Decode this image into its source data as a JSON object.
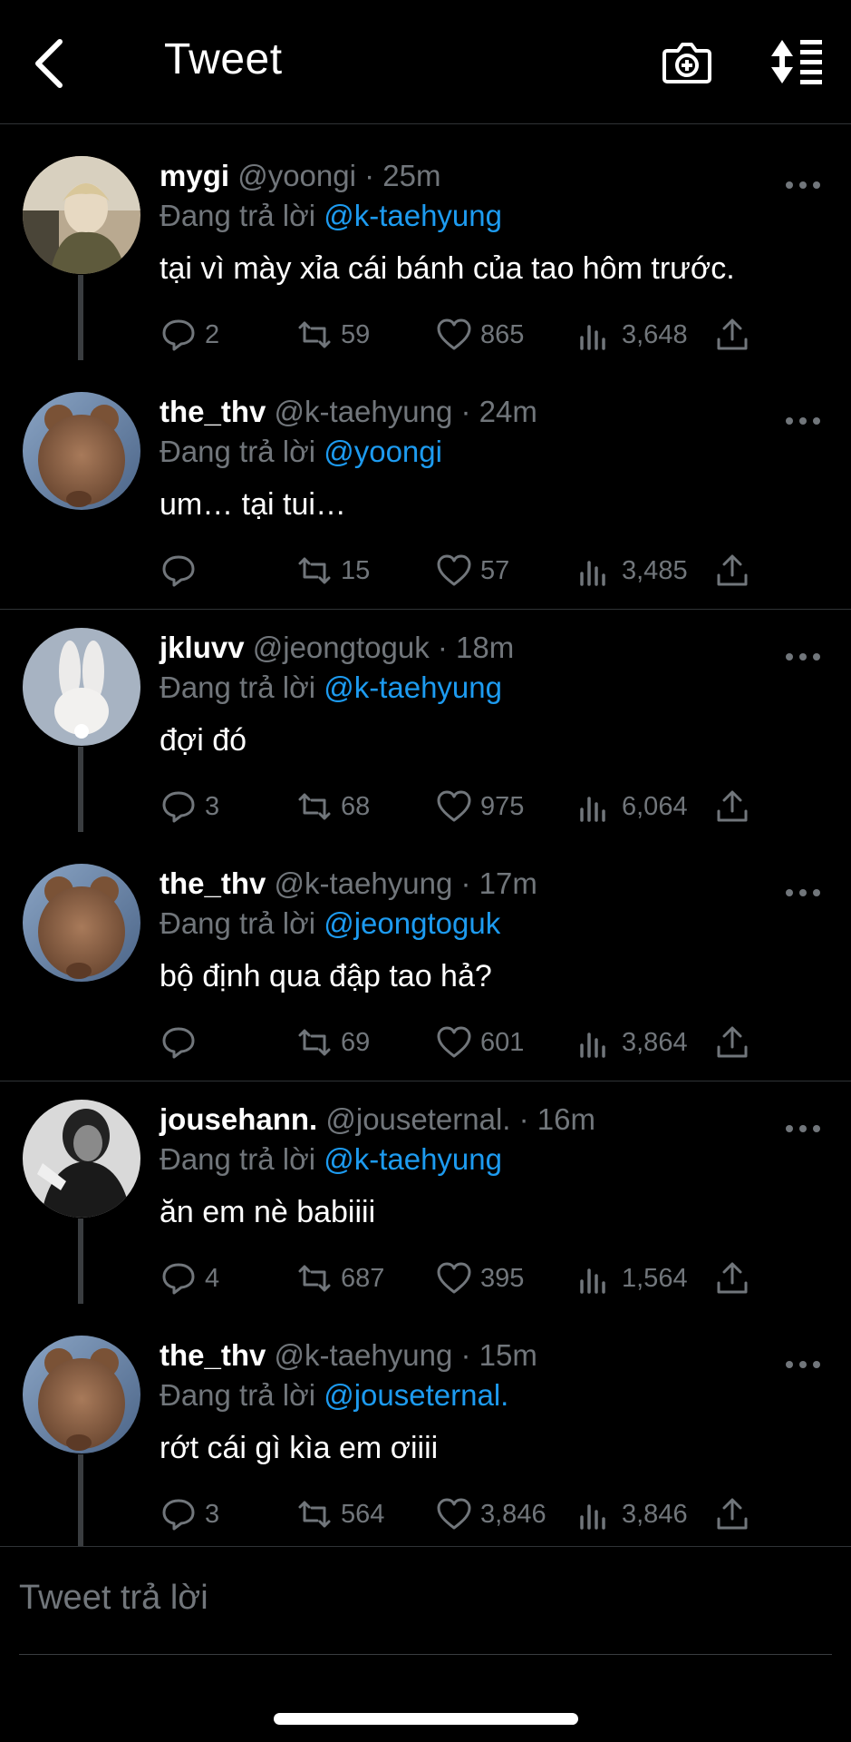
{
  "header": {
    "title": "Tweet",
    "back_icon": "chevron-left-icon",
    "camera_icon": "camera-plus-icon",
    "sort_icon": "sort-list-icon"
  },
  "colors": {
    "background": "#000000",
    "mention": "#1d9bf0",
    "muted": "#71767b",
    "divider": "#2f3336"
  },
  "tweets": [
    {
      "name": "mygi",
      "handle": "@yoongi · 25m",
      "reply_prefix": "Đang trả lời ",
      "reply_to": "@k-taehyung",
      "text": "tại vì mày xỉa cái bánh của tao hôm trước.",
      "replies": "2",
      "retweets": "59",
      "likes": "865",
      "views": "3,648",
      "avatar": "portrait-photo"
    },
    {
      "name": "the_thv",
      "handle": "@k-taehyung · 24m",
      "reply_prefix": "Đang trả lời ",
      "reply_to": "@yoongi",
      "text": "um… tại tui…",
      "replies": "",
      "retweets": "15",
      "likes": "57",
      "views": "3,485",
      "avatar": "teddy-bear-photo"
    },
    {
      "name": "jkluvv",
      "handle": "@jeongtoguk · 18m",
      "reply_prefix": "Đang trả lời ",
      "reply_to": "@k-taehyung",
      "text": "đợi đó",
      "replies": "3",
      "retweets": "68",
      "likes": "975",
      "views": "6,064",
      "avatar": "plush-bunny-photo"
    },
    {
      "name": "the_thv",
      "handle": "@k-taehyung · 17m",
      "reply_prefix": "Đang trả lời ",
      "reply_to": "@jeongtoguk",
      "text": "bộ định qua đập tao hả?",
      "replies": "",
      "retweets": "69",
      "likes": "601",
      "views": "3,864",
      "avatar": "teddy-bear-photo"
    },
    {
      "name": "jousehann.",
      "handle": "@jouseternal. · 16m",
      "reply_prefix": "Đang trả lời ",
      "reply_to": "@k-taehyung",
      "text": "ăn em nè babiiii",
      "replies": "4",
      "retweets": "687",
      "likes": "395",
      "views": "1,564",
      "avatar": "monochrome-portrait-photo"
    },
    {
      "name": "the_thv",
      "handle": "@k-taehyung · 15m",
      "reply_prefix": "Đang trả lời ",
      "reply_to": "@jouseternal.",
      "text": "rớt cái gì kìa em ơiiii",
      "replies": "3",
      "retweets": "564",
      "likes": "3,846",
      "views": "3,846",
      "avatar": "teddy-bear-photo"
    }
  ],
  "reply_box": {
    "placeholder": "Tweet trả lời"
  }
}
